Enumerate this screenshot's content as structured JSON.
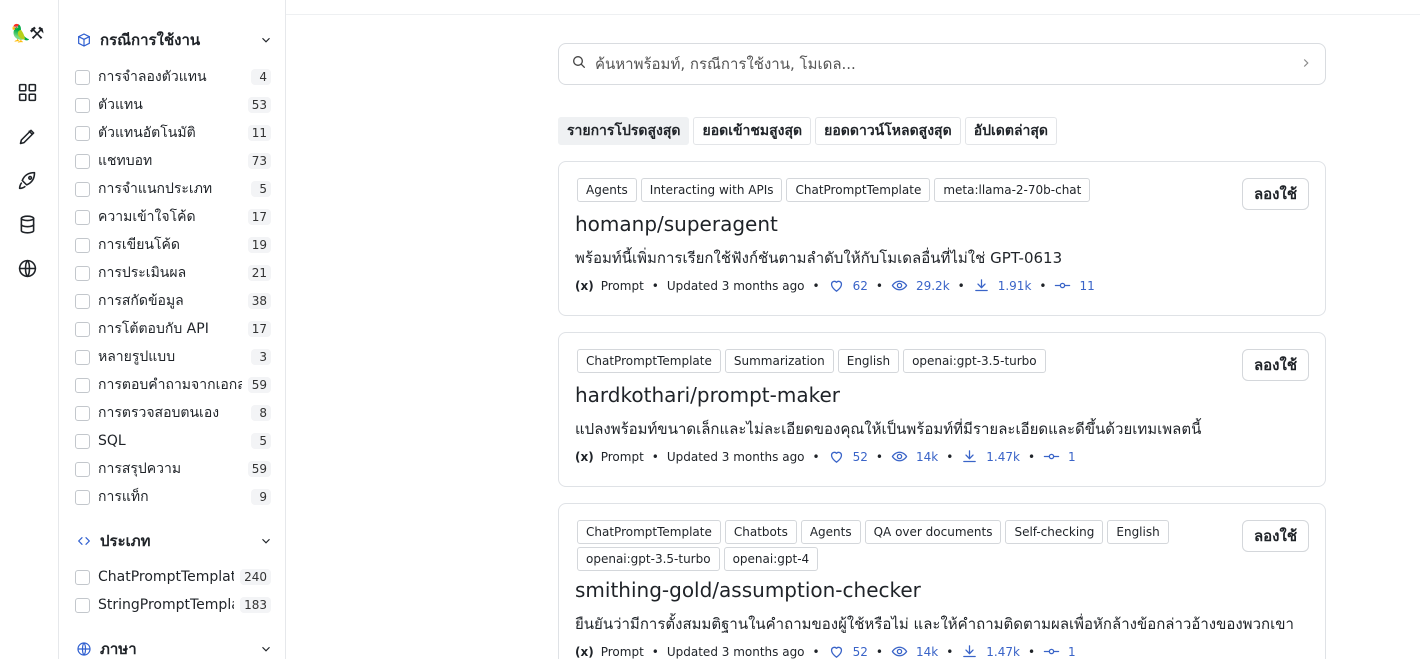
{
  "rail": {
    "logo": "🦜⚒",
    "items": [
      "grid-icon",
      "pencil-icon",
      "rocket-icon",
      "database-icon",
      "globe-icon"
    ]
  },
  "filters": {
    "use_cases": {
      "title": "กรณีการใช้งาน",
      "items": [
        {
          "label": "การจำลองตัวแทน",
          "count": "4"
        },
        {
          "label": "ตัวแทน",
          "count": "53"
        },
        {
          "label": "ตัวแทนอัตโนมัติ",
          "count": "11"
        },
        {
          "label": "แชทบอท",
          "count": "73"
        },
        {
          "label": "การจำแนกประเภท",
          "count": "5"
        },
        {
          "label": "ความเข้าใจโค้ด",
          "count": "17"
        },
        {
          "label": "การเขียนโค้ด",
          "count": "19"
        },
        {
          "label": "การประเมินผล",
          "count": "21"
        },
        {
          "label": "การสกัดข้อมูล",
          "count": "38"
        },
        {
          "label": "การโต้ตอบกับ API",
          "count": "17"
        },
        {
          "label": "หลายรูปแบบ",
          "count": "3"
        },
        {
          "label": "การตอบคำถามจากเอกสาร",
          "count": "59"
        },
        {
          "label": "การตรวจสอบตนเอง",
          "count": "8"
        },
        {
          "label": "SQL",
          "count": "5"
        },
        {
          "label": "การสรุปความ",
          "count": "59"
        },
        {
          "label": "การแท็ก",
          "count": "9"
        }
      ]
    },
    "types": {
      "title": "ประเภท",
      "items": [
        {
          "label": "ChatPromptTemplate",
          "count": "240"
        },
        {
          "label": "StringPromptTemplate",
          "count": "183"
        }
      ]
    },
    "language": {
      "title": "ภาษา"
    }
  },
  "search": {
    "placeholder": "ค้นหาพร้อมท์, กรณีการใช้งาน, โมเดล..."
  },
  "tabs": [
    {
      "label": "รายการโปรดสูงสุด",
      "active": true
    },
    {
      "label": "ยอดเข้าชมสูงสุด",
      "active": false
    },
    {
      "label": "ยอดดาวน์โหลดสูงสุด",
      "active": false
    },
    {
      "label": "อัปเดตล่าสุด",
      "active": false
    }
  ],
  "cards": [
    {
      "tags": [
        "Agents",
        "Interacting with APIs",
        "ChatPromptTemplate",
        "meta:llama-2-70b-chat"
      ],
      "title": "homanp/superagent",
      "description": "พร้อมท์นี้เพิ่มการเรียกใช้ฟังก์ชันตามลำดับให้กับโมเดลอื่นที่ไม่ใช่ GPT-0613",
      "kind": "Prompt",
      "updated": "Updated 3 months ago",
      "likes": "62",
      "views": "29.2k",
      "downloads": "1.91k",
      "commits": "11",
      "try_label": "ลองใช้"
    },
    {
      "tags": [
        "ChatPromptTemplate",
        "Summarization",
        "English",
        "openai:gpt-3.5-turbo"
      ],
      "title": "hardkothari/prompt-maker",
      "description": "แปลงพร้อมท์ขนาดเล็กและไม่ละเอียดของคุณให้เป็นพร้อมท์ที่มีรายละเอียดและดีขึ้นด้วยเทมเพลตนี้",
      "kind": "Prompt",
      "updated": "Updated 3 months ago",
      "likes": "52",
      "views": "14k",
      "downloads": "1.47k",
      "commits": "1",
      "try_label": "ลองใช้"
    },
    {
      "tags": [
        "ChatPromptTemplate",
        "Chatbots",
        "Agents",
        "QA over documents",
        "Self-checking",
        "English",
        "openai:gpt-3.5-turbo",
        "openai:gpt-4"
      ],
      "title": "smithing-gold/assumption-checker",
      "description": "ยืนยันว่ามีการตั้งสมมติฐานในคำถามของผู้ใช้หรือไม่ และให้คำถามติดตามผลเพื่อหักล้างข้อกล่าวอ้างของพวกเขา",
      "kind": "Prompt",
      "updated": "Updated 3 months ago",
      "likes": "52",
      "views": "14k",
      "downloads": "1.47k",
      "commits": "1",
      "try_label": "ลองใช้"
    }
  ]
}
